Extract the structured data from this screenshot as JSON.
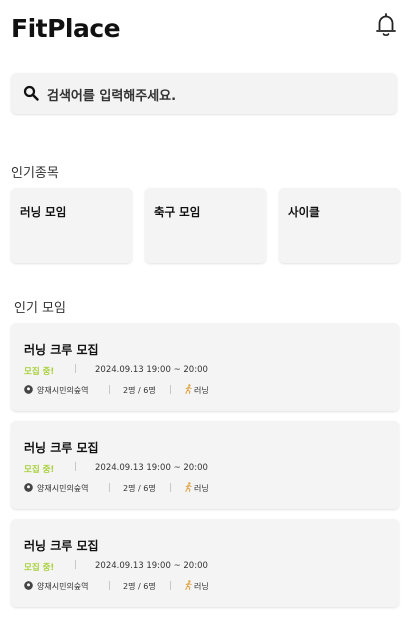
{
  "header": {
    "app_title": "FitPlace",
    "notification_icon": "bell-icon"
  },
  "search": {
    "icon": "search-icon",
    "placeholder": "검색어를 입력해주세요."
  },
  "popular_categories": {
    "title": "인기종목",
    "items": [
      {
        "label": "러닝 모임"
      },
      {
        "label": "축구 모임"
      },
      {
        "label": "사이클"
      }
    ]
  },
  "popular_meetups": {
    "title": "인기 모임",
    "items": [
      {
        "title": "러닝 크루 모집",
        "status": "모집 중!",
        "datetime": "2024.09.13 19:00 ~ 20:00",
        "location": "양재시민의숲역",
        "people": "2명 / 6명",
        "sport": "러닝"
      },
      {
        "title": "러닝 크루 모집",
        "status": "모집 중!",
        "datetime": "2024.09.13 19:00 ~ 20:00",
        "location": "양재시민의숲역",
        "people": "2명 / 6명",
        "sport": "러닝"
      },
      {
        "title": "러닝 크루 모집",
        "status": "모집 중!",
        "datetime": "2024.09.13 19:00 ~ 20:00",
        "location": "양재시민의숲역",
        "people": "2명 / 6명",
        "sport": "러닝"
      }
    ]
  },
  "colors": {
    "status_green": "#a8d13a",
    "card_bg": "#f4f4f4",
    "text": "#111111"
  }
}
